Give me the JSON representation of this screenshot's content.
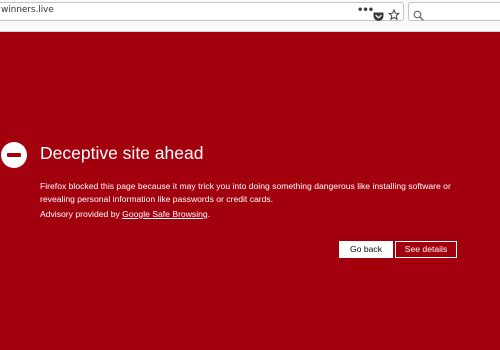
{
  "toolbar": {
    "url": "winners.live",
    "page_actions_icon": "meatball-menu-icon",
    "pocket_icon": "pocket-icon",
    "bookmark_icon": "star-icon",
    "search": {
      "value": "",
      "placeholder": "",
      "icon": "search-icon"
    }
  },
  "error": {
    "icon": "block-icon",
    "title": "Deceptive site ahead",
    "description": "Firefox blocked this page because it may trick you into doing something dangerous like installing software or revealing personal information like passwords or credit cards.",
    "advisory_prefix": "Advisory provided by ",
    "advisory_link": "Google Safe Browsing",
    "advisory_suffix": ".",
    "buttons": {
      "back": "Go back",
      "details": "See details"
    }
  },
  "colors": {
    "background": "#a3000d",
    "toolbar": "#f9f9fa",
    "text": "#ffffff"
  }
}
